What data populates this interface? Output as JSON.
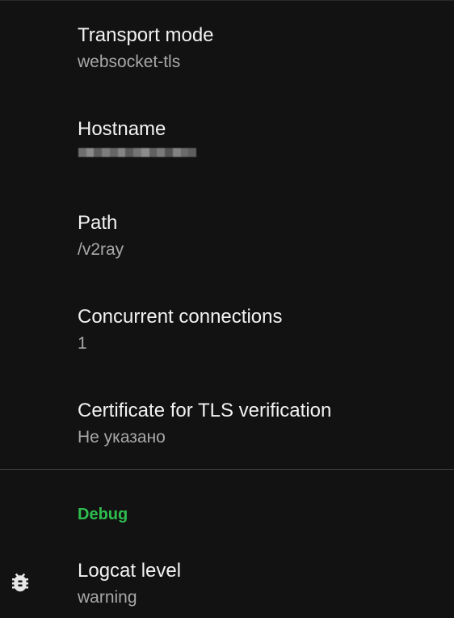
{
  "prefs": [
    {
      "title": "Transport mode",
      "summary": "websocket-tls"
    },
    {
      "title": "Hostname",
      "summary": ""
    },
    {
      "title": "Path",
      "summary": "/v2ray"
    },
    {
      "title": "Concurrent connections",
      "summary": "1"
    },
    {
      "title": "Certificate for TLS verification",
      "summary": "Не указано"
    }
  ],
  "debug": {
    "category": "Debug",
    "logcat": {
      "title": "Logcat level",
      "summary": "warning"
    },
    "icon": "bug-icon"
  },
  "colors": {
    "background": "#121212",
    "accent": "#2ebd4e",
    "title": "#f2f2f2",
    "summary": "#a8a8a8"
  }
}
